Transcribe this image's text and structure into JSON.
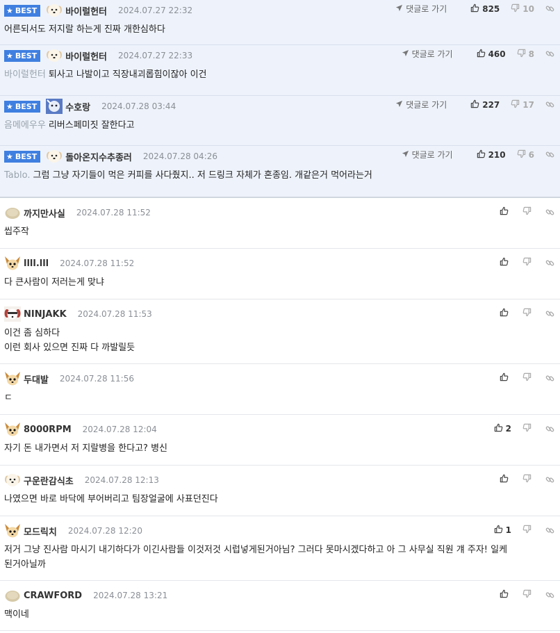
{
  "best_badge_label": "BEST",
  "reply_label": "댓글로 가기",
  "comments": [
    {
      "best": true,
      "avatar": "puppy-white",
      "nickname": "바이럴헌터",
      "date": "2024.07.27 22:32",
      "mention": "",
      "lines": [
        "어른되서도 저지랄 하는게 진짜 개한심하다"
      ],
      "up": "825",
      "down": "10"
    },
    {
      "best": true,
      "avatar": "puppy-white",
      "nickname": "바이럴헌터",
      "date": "2024.07.27 22:33",
      "mention": "바이럴헌터",
      "lines": [
        "퇴사고 나발이고 직장내괴롭힘이잖아 이건"
      ],
      "up": "460",
      "down": "8"
    },
    {
      "best": true,
      "avatar": "blue-creature",
      "nickname": "수호랑",
      "date": "2024.07.28 03:44",
      "mention": "음메에우우",
      "lines": [
        "리버스페미짓 잘한다고"
      ],
      "up": "227",
      "down": "17"
    },
    {
      "best": true,
      "avatar": "puppy-white",
      "nickname": "돌아온지수추종러",
      "date": "2024.07.28 04:26",
      "mention": "Tablo.",
      "lines": [
        "그럼 그냥 자기들이 먹은 커피를 사다줬지.. 저 드링크 자체가 혼종임. 개같은거 먹어라는거"
      ],
      "up": "210",
      "down": "6"
    },
    {
      "best": false,
      "avatar": "potato",
      "nickname": "까지만사실",
      "date": "2024.07.28 11:52",
      "mention": "",
      "lines": [
        "씹주작"
      ],
      "up": "",
      "down": ""
    },
    {
      "best": false,
      "avatar": "chihuahua",
      "nickname": "llll.lll",
      "date": "2024.07.28 11:52",
      "mention": "",
      "lines": [
        "다 큰사람이 저러는게 맞냐"
      ],
      "up": "",
      "down": ""
    },
    {
      "best": false,
      "avatar": "ninja-dog",
      "nickname": "NINJAKK",
      "date": "2024.07.28 11:53",
      "mention": "",
      "lines": [
        "이건 좀 심하다",
        "이런 회사 있으면 진짜 다 까발릴듯"
      ],
      "up": "",
      "down": ""
    },
    {
      "best": false,
      "avatar": "chihuahua",
      "nickname": "두대발",
      "date": "2024.07.28 11:56",
      "mention": "",
      "lines": [
        "ㄷ"
      ],
      "up": "",
      "down": ""
    },
    {
      "best": false,
      "avatar": "chihuahua",
      "nickname": "8000RPM",
      "date": "2024.07.28 12:04",
      "mention": "",
      "lines": [
        "자기 돈 내가면서 저 지랄병을 한다고? 병신"
      ],
      "up": "2",
      "down": ""
    },
    {
      "best": false,
      "avatar": "puppy-white",
      "nickname": "구운란감식초",
      "date": "2024.07.28 12:13",
      "mention": "",
      "lines": [
        "나였으면 바로 바닥에 부어버리고 팀장얼굴에 사표던진다"
      ],
      "up": "",
      "down": ""
    },
    {
      "best": false,
      "avatar": "chihuahua",
      "nickname": "모드릭치",
      "date": "2024.07.28 12:20",
      "mention": "",
      "lines": [
        "저거 그냥 진사람 마시기 내기하다가 이긴사람들 이것저것 시럽넣게된거아님? 그러다 못마시겠다하고 아 그 사무실 직원 걔 주자! 일케",
        "된거아닐까"
      ],
      "up": "1",
      "down": ""
    },
    {
      "best": false,
      "avatar": "potato",
      "nickname": "CRAWFORD",
      "date": "2024.07.28 13:21",
      "mention": "",
      "lines": [
        "맥이네"
      ],
      "up": "",
      "down": ""
    }
  ],
  "colors": {
    "accent": "#3f7fe0",
    "best_bg": "#eef3fb"
  }
}
